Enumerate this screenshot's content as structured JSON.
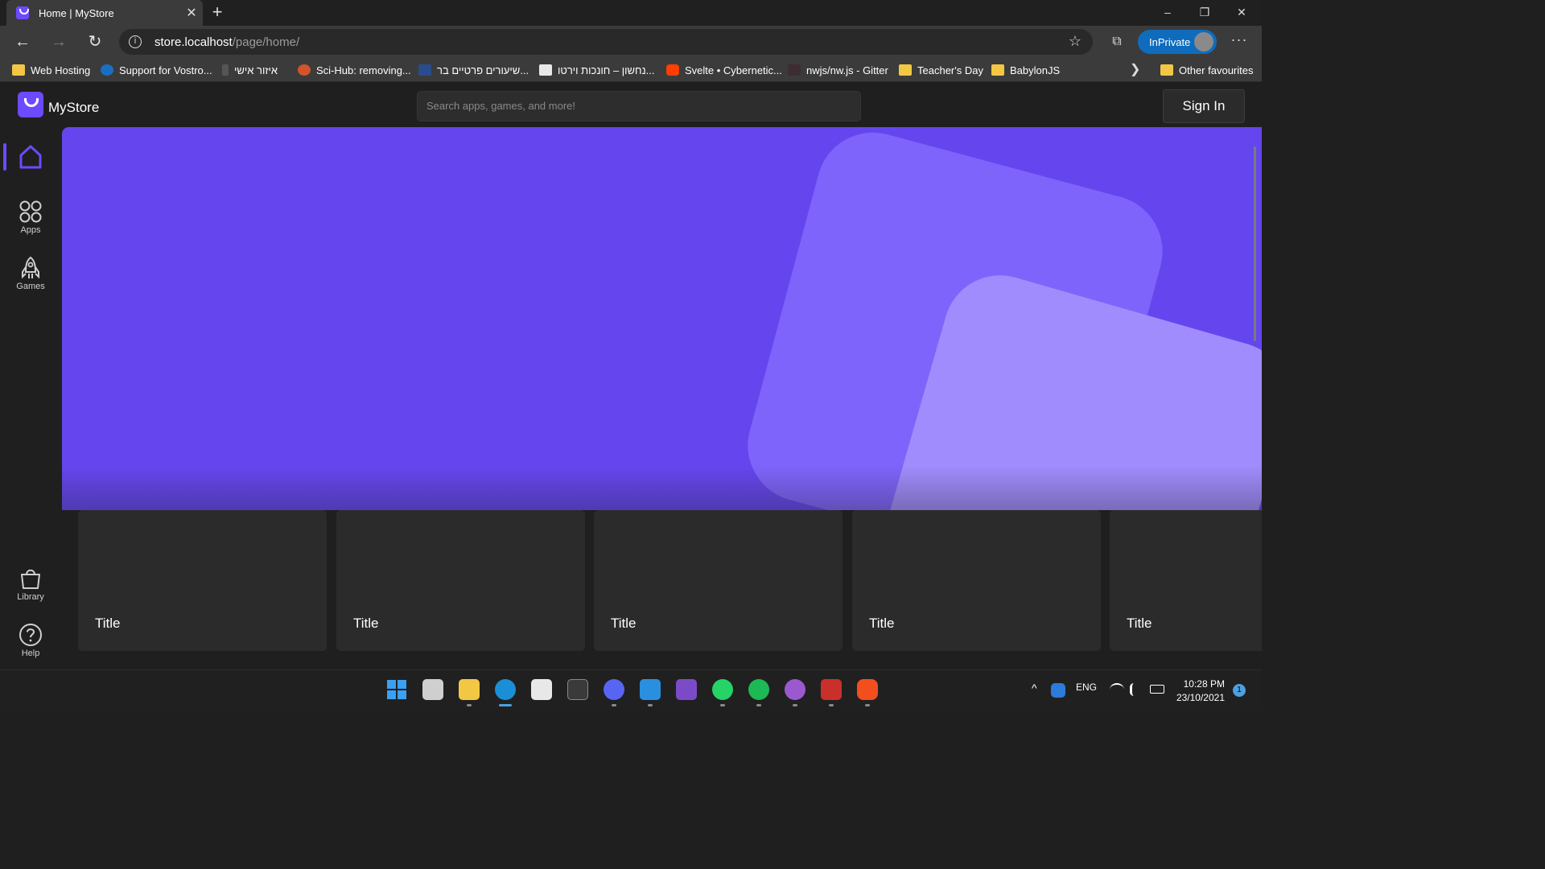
{
  "browser": {
    "tab_title": "Home | MyStore",
    "url_host": "store.localhost",
    "url_path": "/page/home/",
    "inprivate_label": "InPrivate",
    "bookmarks": [
      {
        "label": "Web Hosting",
        "icon": "folder-icon"
      },
      {
        "label": "Support for Vostro...",
        "icon": "dell-icon"
      },
      {
        "label": "איזור אישי",
        "icon": "site-icon"
      },
      {
        "label": "Sci-Hub: removing...",
        "icon": "scihub-icon"
      },
      {
        "label": "שיעורים פרטיים בר...",
        "icon": "site-icon"
      },
      {
        "label": "נחשון – חונכות וירטו...",
        "icon": "site-icon"
      },
      {
        "label": "Svelte • Cybernetic...",
        "icon": "svelte-icon"
      },
      {
        "label": "nwjs/nw.js - Gitter",
        "icon": "gitter-icon"
      },
      {
        "label": "Teacher's Day",
        "icon": "folder-icon"
      },
      {
        "label": "BabylonJS",
        "icon": "folder-icon"
      }
    ],
    "other_favourites": "Other favourites"
  },
  "app": {
    "brand": "MyStore",
    "search_placeholder": "Search apps, games, and more!",
    "sign_in": "Sign In",
    "accent_color": "#6546ee",
    "sidebar": {
      "apps": "Apps",
      "games": "Games",
      "library": "Library",
      "help": "Help"
    },
    "cards": [
      {
        "title": "Title"
      },
      {
        "title": "Title"
      },
      {
        "title": "Title"
      },
      {
        "title": "Title"
      },
      {
        "title": "Title"
      }
    ]
  },
  "taskbar": {
    "language": "ENG",
    "time": "10:28 PM",
    "date": "23/10/2021",
    "notifications": "1"
  }
}
